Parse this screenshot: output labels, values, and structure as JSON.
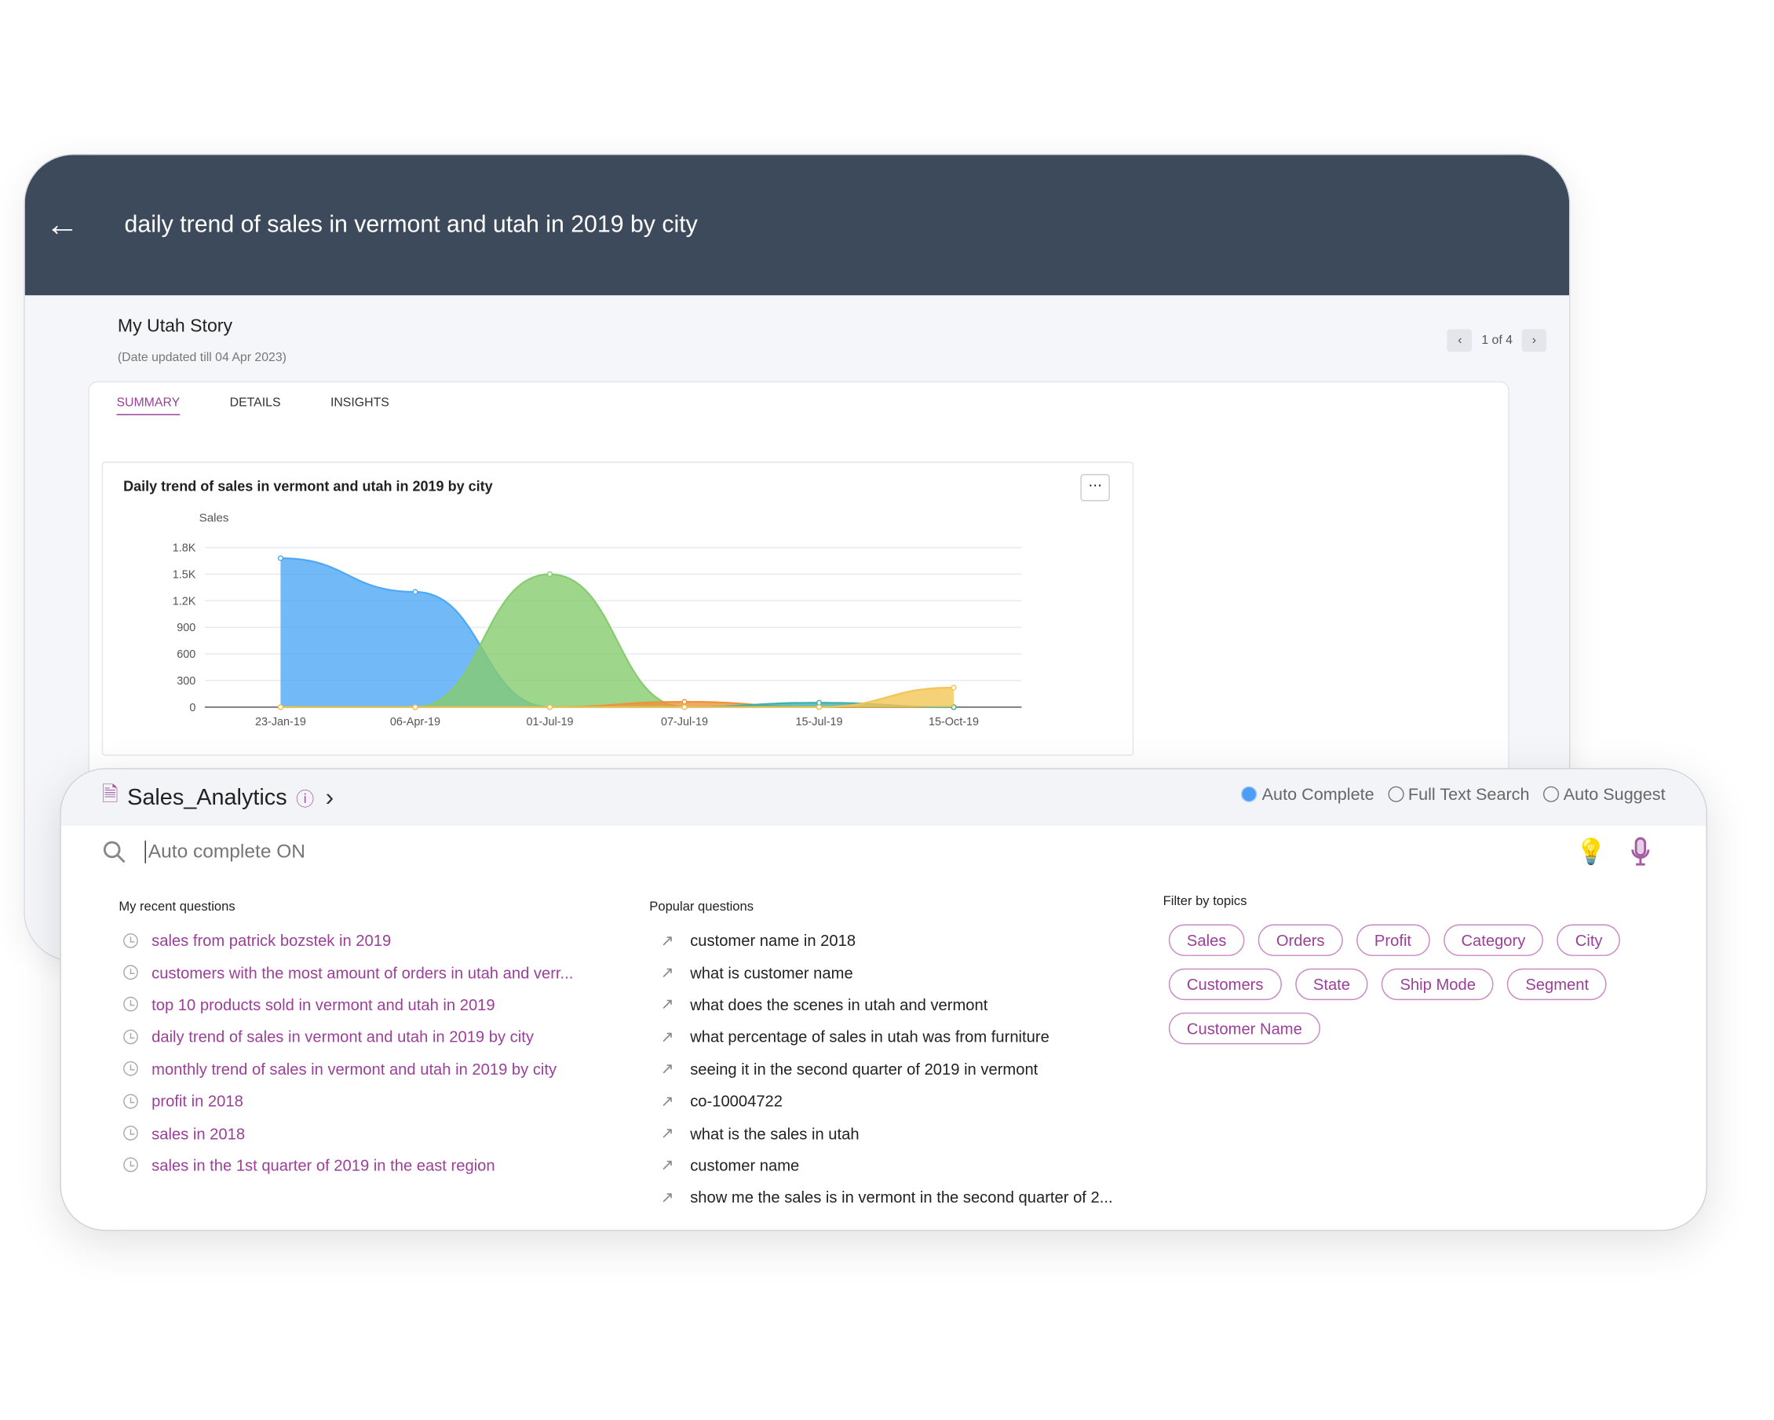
{
  "header": {
    "title": "daily trend of sales in vermont and utah in 2019 by city"
  },
  "story": {
    "title": "My Utah Story",
    "date": "(Date updated till 04 Apr 2023)",
    "pager": "1 of 4"
  },
  "tabs": [
    "SUMMARY",
    "DETAILS",
    "INSIGHTS"
  ],
  "chart_data": {
    "type": "area",
    "title": "Daily trend of sales in vermont and utah in 2019 by city",
    "ylabel": "Sales",
    "xlabel": "",
    "categories": [
      "23-Jan-19",
      "06-Apr-19",
      "01-Jul-19",
      "07-Jul-19",
      "15-Jul-19",
      "15-Oct-19"
    ],
    "yticks": [
      "0",
      "300",
      "600",
      "900",
      "1.2K",
      "1.5K",
      "1.8K"
    ],
    "ylim": [
      0,
      1800
    ],
    "grid": true,
    "series": [
      {
        "color": "#4da8f5",
        "values": [
          1680,
          1300,
          0,
          0,
          0,
          0
        ]
      },
      {
        "color": "#86cc6e",
        "values": [
          0,
          0,
          1500,
          0,
          0,
          0
        ]
      },
      {
        "color": "#f0923a",
        "values": [
          0,
          0,
          0,
          60,
          0,
          0
        ]
      },
      {
        "color": "#3fb0b0",
        "values": [
          0,
          0,
          0,
          0,
          50,
          0
        ]
      },
      {
        "color": "#f2c555",
        "values": [
          0,
          0,
          0,
          0,
          0,
          220
        ]
      }
    ]
  },
  "search": {
    "dataset": "Sales_Analytics",
    "modes": [
      "Auto Complete",
      "Full Text Search",
      "Auto Suggest"
    ],
    "selected_mode": "Auto Complete",
    "placeholder": "Auto complete ON"
  },
  "recent": {
    "title": "My recent questions",
    "items": [
      "sales from patrick bozstek in 2019",
      "customers with the most amount of orders in utah and verr...",
      "top 10 products sold in vermont and utah in 2019",
      "daily trend of sales in vermont and utah in 2019 by city",
      "monthly trend of sales in vermont and utah in 2019 by city",
      "profit in 2018",
      "sales in 2018",
      "sales in the 1st quarter of 2019 in the east region"
    ]
  },
  "popular": {
    "title": "Popular questions",
    "items": [
      "customer name in 2018",
      "what is customer name",
      "what does the scenes in utah and vermont",
      "what percentage of sales in utah was from furniture",
      "seeing it in the second quarter of 2019 in vermont",
      "co-10004722",
      "what is the sales in utah",
      "customer name",
      "show me the sales is in vermont in the second quarter of 2..."
    ]
  },
  "topics": {
    "title": "Filter by topics",
    "items": [
      "Sales",
      "Orders",
      "Profit",
      "Category",
      "City",
      "Customers",
      "State",
      "Ship Mode",
      "Segment",
      "Customer Name"
    ]
  }
}
